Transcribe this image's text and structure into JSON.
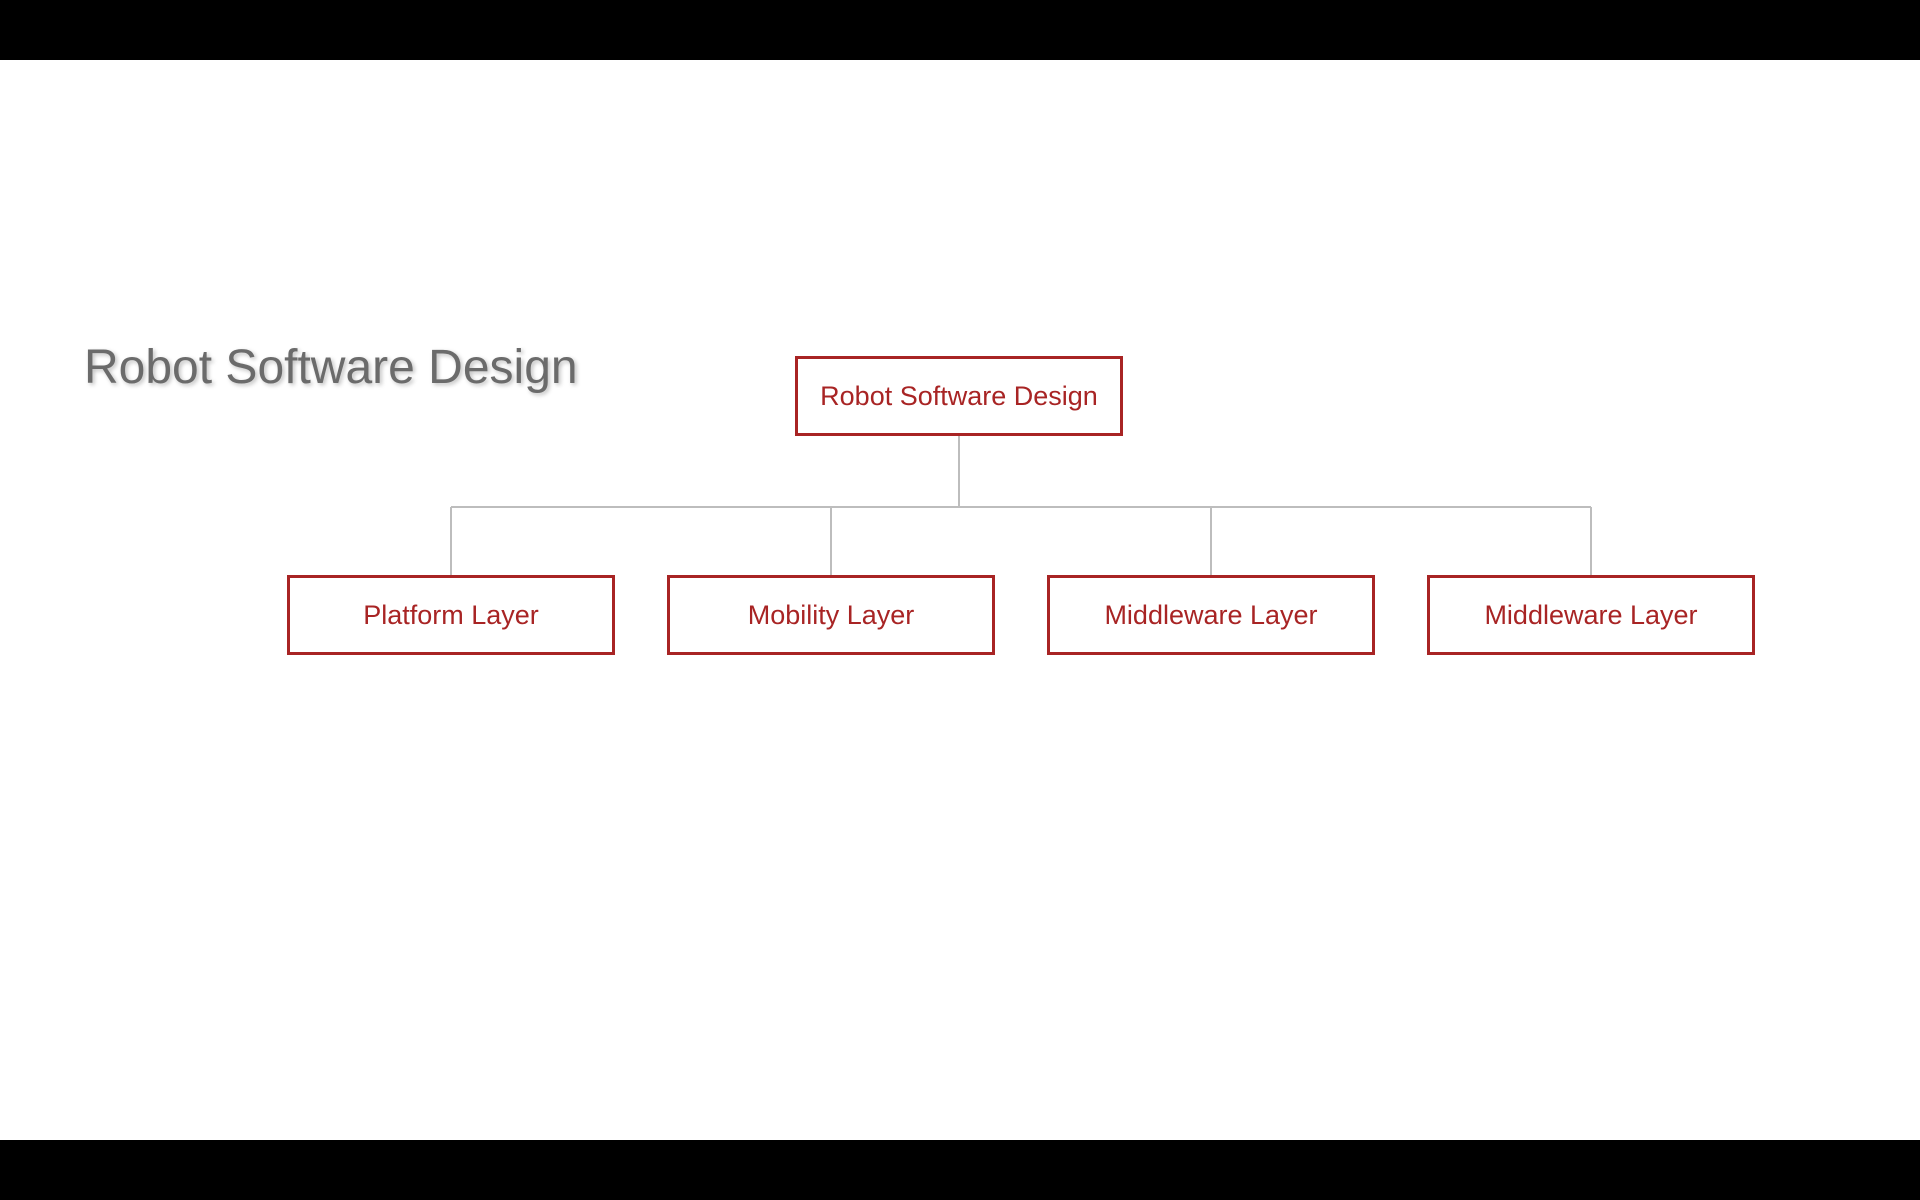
{
  "title": "Robot Software Design",
  "diagram": {
    "root": "Robot Software Design",
    "children": [
      "Platform Layer",
      "Mobility Layer",
      "Middleware Layer",
      "Middleware Layer"
    ]
  },
  "colors": {
    "box_border": "#a82424",
    "box_text": "#a82424",
    "title_text": "#6b6b6b",
    "connector": "#bdbdbd"
  }
}
